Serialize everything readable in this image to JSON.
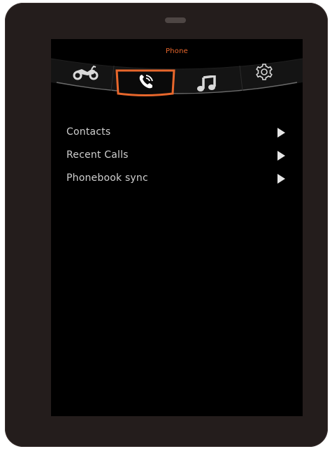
{
  "header": {
    "title": "Phone"
  },
  "tabs": [
    {
      "id": "bike",
      "icon": "motorcycle-icon",
      "selected": false
    },
    {
      "id": "phone",
      "icon": "phone-icon",
      "selected": true
    },
    {
      "id": "music",
      "icon": "music-note-icon",
      "selected": false
    },
    {
      "id": "settings",
      "icon": "gear-icon",
      "selected": false
    }
  ],
  "menu": {
    "items": [
      {
        "label": "Contacts"
      },
      {
        "label": "Recent Calls"
      },
      {
        "label": "Phonebook sync"
      }
    ]
  },
  "colors": {
    "accent": "#e8672c",
    "text": "#cfcfcf",
    "background": "#000000",
    "bezel": "#241d1c"
  }
}
